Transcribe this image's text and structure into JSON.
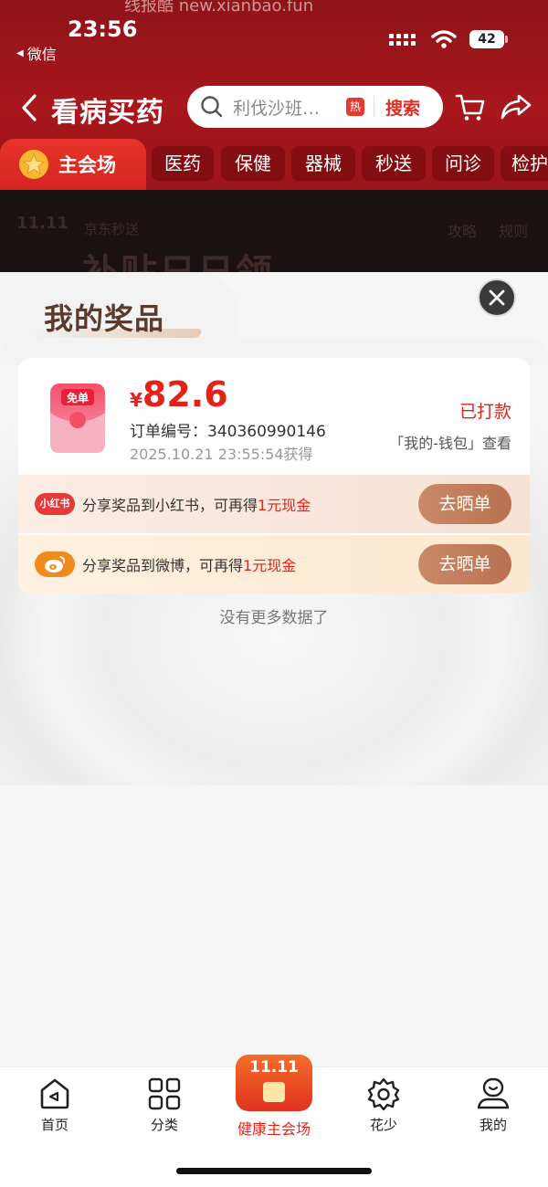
{
  "status_bar": {
    "time": "23:56",
    "back_app": "微信",
    "battery": "42",
    "ghost_text": "线报酷 new.xianbao.fun"
  },
  "header": {
    "title": "看病买药",
    "search_placeholder": "利伐沙班…",
    "hot_badge": "热",
    "search_button": "搜索"
  },
  "tabs": {
    "main": "主会场",
    "items": [
      "医药",
      "保健",
      "器械",
      "秒送",
      "问诊",
      "检护"
    ]
  },
  "banner": {
    "event": "11.11",
    "brand": "京东秒送",
    "title": "补贴日日领",
    "links": [
      "攻略",
      "规则"
    ]
  },
  "prize_panel": {
    "title": "我的奖品",
    "card": {
      "icon_label": "免单",
      "currency": "¥",
      "amount": "82.6",
      "order_label": "订单编号：340360990146",
      "obtained_time": "2025.10.21 23:55:54获得",
      "status": "已打款",
      "wallet_hint": "「我的-钱包」查看"
    },
    "share_rows": [
      {
        "platform_badge": "小红书",
        "text_prefix": "分享奖品到小红书，可再得",
        "reward": "1元现金",
        "button": "去晒单"
      },
      {
        "platform_badge": "微博",
        "text_prefix": "分享奖品到微博，可再得",
        "reward": "1元现金",
        "button": "去晒单"
      }
    ],
    "no_more": "没有更多数据了"
  },
  "bottom_nav": {
    "items": [
      "首页",
      "分类",
      "花少",
      "我的"
    ],
    "center": {
      "badge": "11.11",
      "label": "健康主会场"
    }
  },
  "colors": {
    "header_red": "#a8171c",
    "accent_red": "#e2231a",
    "share_button": "#b9714f"
  }
}
